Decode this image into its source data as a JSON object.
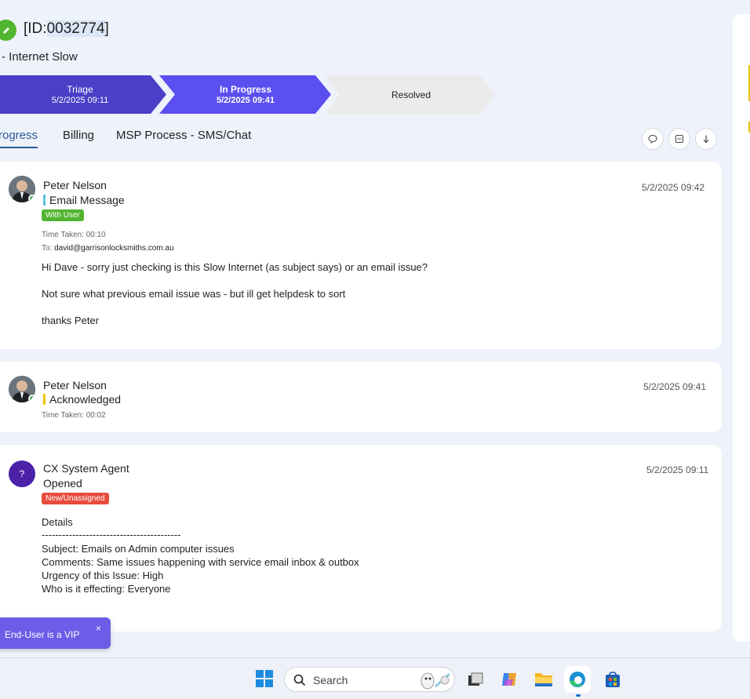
{
  "ticket": {
    "id_prefix": "[ID:",
    "id_number": "0032774",
    "id_suffix": "]",
    "subject": "- Internet Slow"
  },
  "stages": [
    {
      "name": "Triage",
      "date": "5/2/2025 09:11"
    },
    {
      "name": "In Progress",
      "date": "5/2/2025 09:41"
    },
    {
      "name": "Resolved",
      "date": ""
    }
  ],
  "tabs": [
    {
      "label": "rogress"
    },
    {
      "label": "Billing"
    },
    {
      "label": "MSP Process - SMS/Chat"
    }
  ],
  "entries": [
    {
      "author": "Peter Nelson",
      "type": "Email Message",
      "badge": "With User",
      "time_taken": "Time Taken: 00:10",
      "to_label": "To:",
      "to_value": "david@garrisonlocksmiths.com.au",
      "timestamp": "5/2/2025 09:42",
      "lines": [
        "Hi Dave - sorry just checking is this Slow Internet (as subject says) or an email issue?",
        "Not sure what previous email issue was - but ill get helpdesk to sort",
        "thanks Peter"
      ]
    },
    {
      "author": "Peter Nelson",
      "type": "Acknowledged",
      "time_taken": "Time Taken: 00:02",
      "timestamp": "5/2/2025 09:41"
    },
    {
      "author": "CX System Agent",
      "avatar_text": "?",
      "type": "Opened",
      "badge": "New/Unassigned",
      "timestamp": "5/2/2025 09:11",
      "lines": [
        "Details",
        "-----------------------------------------",
        "Subject: Emails on Admin computer issues",
        "Comments: Same issues happening with service email inbox & outbox",
        "Urgency of this Issue: High",
        "Who is it effecting: Everyone"
      ]
    }
  ],
  "vip": {
    "text": "End-User is a VIP",
    "close": "×"
  },
  "taskbar": {
    "search_label": "Search"
  },
  "colors": {
    "stage_triage": "#4a3fc7",
    "stage_in_progress": "#5b4ff0",
    "stage_resolved": "#ebebeb",
    "badge_with_user": "#52b52f",
    "badge_new": "#e84b3c",
    "bar_email": "#5bc0de",
    "bar_ack": "#f1c40f",
    "vip": "#6c5ce7"
  }
}
